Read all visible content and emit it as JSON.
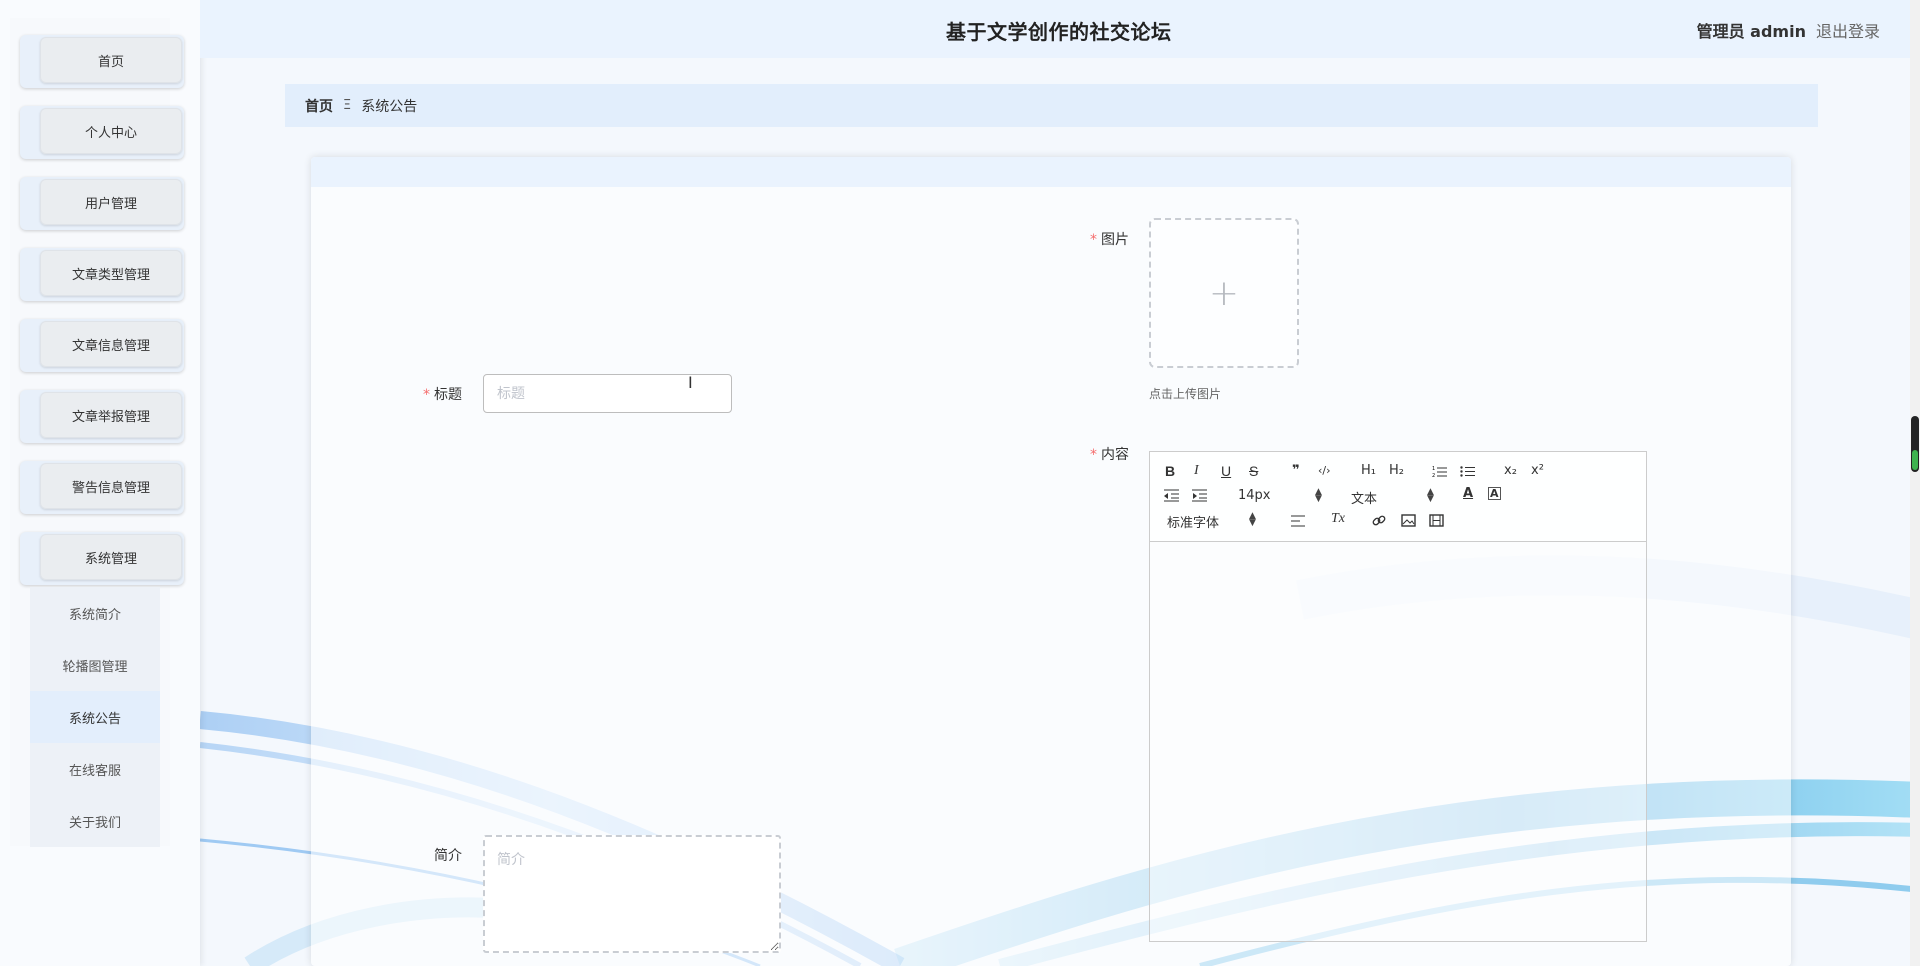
{
  "header": {
    "site_title": "基于文学创作的社交论坛",
    "admin_label": "管理员 admin",
    "logout": "退出登录"
  },
  "sidebar": {
    "items": [
      {
        "label": "首页"
      },
      {
        "label": "个人中心"
      },
      {
        "label": "用户管理"
      },
      {
        "label": "文章类型管理"
      },
      {
        "label": "文章信息管理"
      },
      {
        "label": "文章举报管理"
      },
      {
        "label": "警告信息管理"
      },
      {
        "label": "系统管理"
      }
    ],
    "submenu": [
      {
        "label": "系统简介"
      },
      {
        "label": "轮播图管理"
      },
      {
        "label": "系统公告",
        "active": true
      },
      {
        "label": "在线客服"
      },
      {
        "label": "关于我们"
      }
    ]
  },
  "breadcrumb": {
    "home": "首页",
    "separator": "Ξ",
    "current": "系统公告"
  },
  "form": {
    "title_label": "标题",
    "title_placeholder": "标题",
    "image_label": "图片",
    "upload_tip": "点击上传图片",
    "content_label": "内容",
    "intro_label": "简介",
    "intro_placeholder": "简介",
    "required_mark": "*"
  },
  "editor": {
    "font_size": "14px",
    "header_select": "文本",
    "font_family": "标准字体",
    "buttons": {
      "bold": "B",
      "italic": "I",
      "underline": "U",
      "strike": "S",
      "quote": "❞",
      "code": "‹/›",
      "h1": "H₁",
      "h2": "H₂",
      "sub": "x₂",
      "sup": "x²",
      "clean": "Tx"
    }
  },
  "colors": {
    "accent_blue": "#3a8ee6",
    "header_bg": "#eaf3fe",
    "required": "#f56c6c"
  }
}
